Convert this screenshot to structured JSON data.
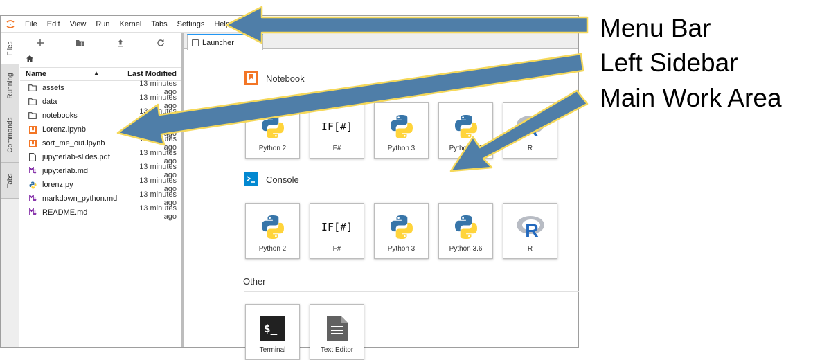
{
  "menubar": {
    "items": [
      "File",
      "Edit",
      "View",
      "Run",
      "Kernel",
      "Tabs",
      "Settings",
      "Help"
    ]
  },
  "activity_tabs": [
    "Files",
    "Running",
    "Commands",
    "Tabs"
  ],
  "file_browser": {
    "toolbar_icons": [
      "plus-icon",
      "new-folder-icon",
      "upload-icon",
      "refresh-icon"
    ],
    "breadcrumb_icon": "home-icon",
    "columns": {
      "name": "Name",
      "modified": "Last Modified"
    },
    "files": [
      {
        "name": "assets",
        "modified": "13 minutes ago",
        "icon": "folder-icon"
      },
      {
        "name": "data",
        "modified": "13 minutes ago",
        "icon": "folder-icon"
      },
      {
        "name": "notebooks",
        "modified": "13 minutes ago",
        "icon": "folder-icon"
      },
      {
        "name": "Lorenz.ipynb",
        "modified": "13 minutes ago",
        "icon": "notebook-icon"
      },
      {
        "name": "sort_me_out.ipynb",
        "modified": "13 minutes ago",
        "icon": "notebook-icon"
      },
      {
        "name": "jupyterlab-slides.pdf",
        "modified": "13 minutes ago",
        "icon": "file-icon"
      },
      {
        "name": "jupyterlab.md",
        "modified": "13 minutes ago",
        "icon": "markdown-icon"
      },
      {
        "name": "lorenz.py",
        "modified": "13 minutes ago",
        "icon": "python-file-icon"
      },
      {
        "name": "markdown_python.md",
        "modified": "13 minutes ago",
        "icon": "markdown-icon"
      },
      {
        "name": "README.md",
        "modified": "13 minutes ago",
        "icon": "markdown-icon"
      }
    ]
  },
  "launcher": {
    "tab_label": "Launcher",
    "sections": {
      "notebook": {
        "title": "Notebook",
        "cards": [
          "Python 2",
          "F#",
          "Python 3",
          "Python 3.6",
          "R"
        ]
      },
      "console": {
        "title": "Console",
        "cards": [
          "Python 2",
          "F#",
          "Python 3",
          "Python 3.6",
          "R"
        ]
      },
      "other": {
        "title": "Other",
        "cards": [
          "Terminal",
          "Text Editor"
        ]
      }
    },
    "fsharp_glyph": "IF[#]",
    "r_glyph": "R",
    "terminal_glyph": "$_"
  },
  "annotations": [
    "Menu Bar",
    "Left Sidebar",
    "Main Work Area"
  ],
  "colors": {
    "accent_blue": "#2196f3",
    "notebook_orange": "#f37626",
    "arrow_fill": "#4f7ea8",
    "arrow_outline": "#f5d85a"
  }
}
